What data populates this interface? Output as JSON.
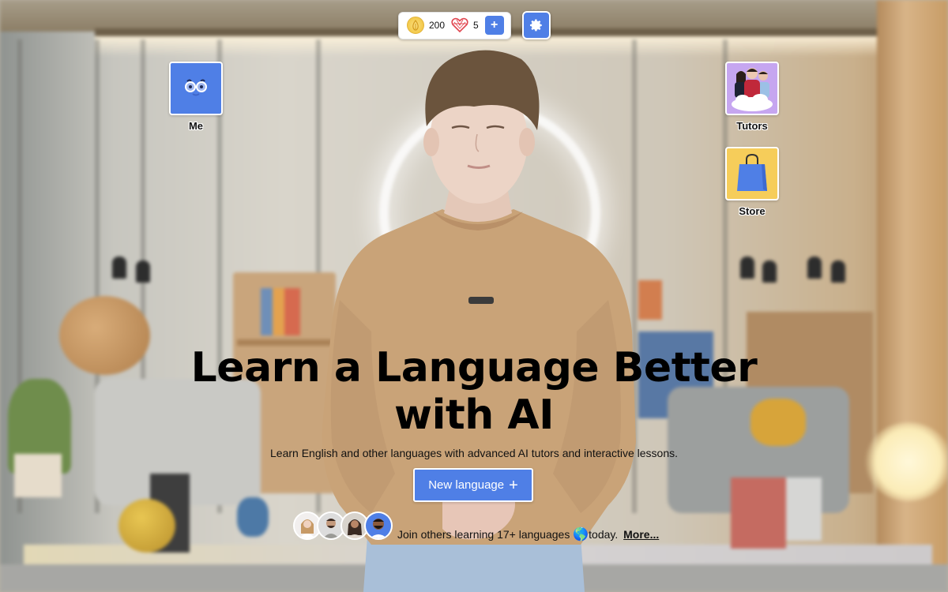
{
  "topbar": {
    "coins": "200",
    "lives": "5",
    "add_label": "+",
    "coin_icon": "coin-icon",
    "heart_icon": "heart-icon",
    "settings_icon": "gear-icon"
  },
  "tiles": [
    {
      "label": "Me",
      "icon": "face-with-glasses-icon",
      "color": "#4f7fe6"
    },
    {
      "label": "Tutors",
      "icon": "tutors-group-icon",
      "color": "#c6a6f0"
    },
    {
      "label": "Store",
      "icon": "shopping-bag-icon",
      "color": "#f6cd5a"
    }
  ],
  "hero": {
    "title": "Learn a Language Better with AI",
    "subtitle": "Learn English and other languages with advanced AI tutors and interactive lessons.",
    "cta_label": "New language",
    "cta_icon": "+"
  },
  "social": {
    "avatar_count": 4,
    "text_before": "Join others learning 17+ languages ",
    "globe": "🌎",
    "text_after": "today.",
    "more_label": "More..."
  },
  "colors": {
    "accent": "#4f7fe6",
    "coin": "#f3c94a",
    "heart": "#e0454f"
  }
}
